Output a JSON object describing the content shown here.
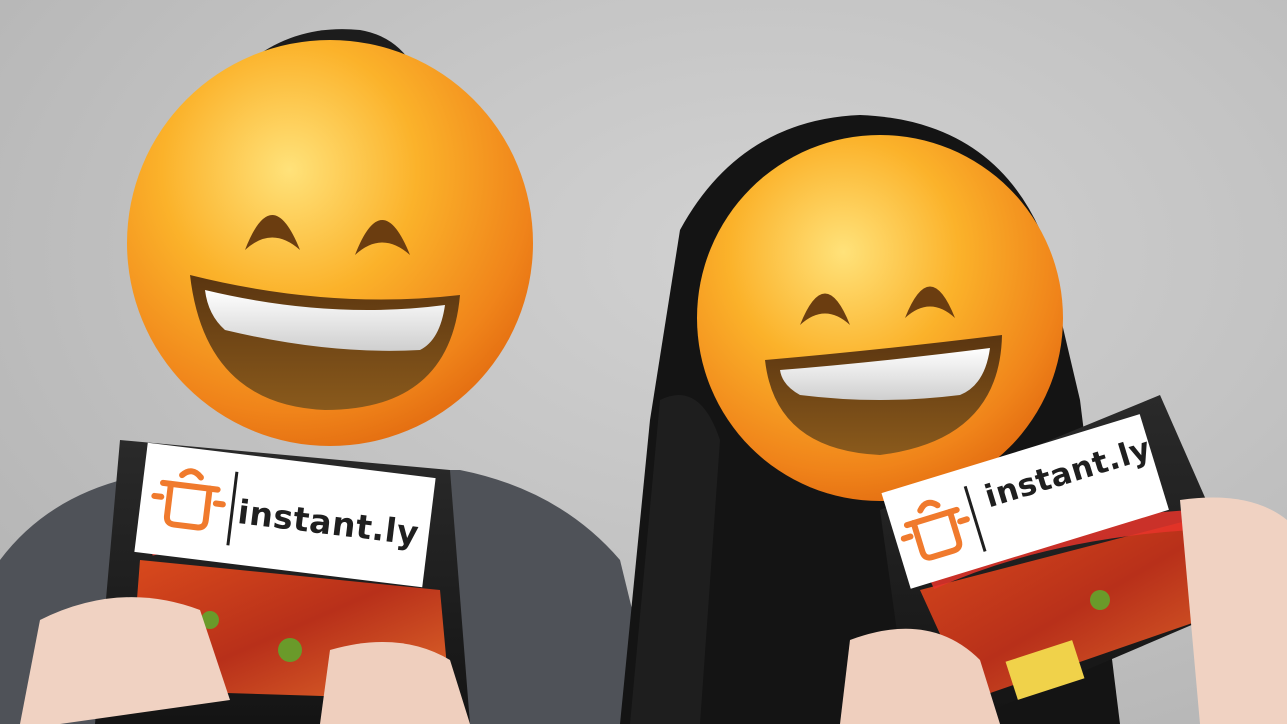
{
  "image": {
    "subject": "two-people-holding-instant-noodle-packs",
    "background_color": "#c6c6c6",
    "accent_color": "#f07a2d",
    "face_emoji": "smiling-face-with-open-mouth-and-smiling-eyes"
  },
  "stickers": [
    {
      "brand_text": "instant.ly",
      "icon": "cooking-pot-icon"
    },
    {
      "brand_text": "instant.ly",
      "icon": "cooking-pot-icon"
    }
  ]
}
